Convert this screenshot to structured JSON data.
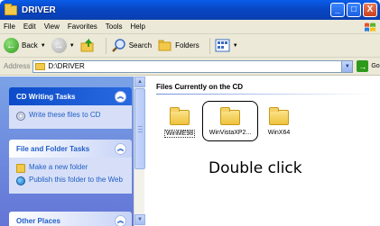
{
  "window": {
    "title": "DRIVER",
    "buttons": {
      "minimize": "_",
      "maximize": "□",
      "close": "X"
    }
  },
  "menu": [
    "File",
    "Edit",
    "View",
    "Favorites",
    "Tools",
    "Help"
  ],
  "toolbar": {
    "back_label": "Back",
    "search_label": "Search",
    "folders_label": "Folders"
  },
  "address": {
    "label": "Address",
    "value": "D:\\DRIVER",
    "go_label": "Go"
  },
  "task_pane": {
    "cd_tasks": {
      "title": "CD Writing Tasks",
      "items": [
        "Write these files to CD"
      ]
    },
    "file_folder_tasks": {
      "title": "File and Folder Tasks",
      "items": [
        "Make a new folder",
        "Publish this folder to the Web"
      ]
    },
    "other_places": {
      "title": "Other Places"
    }
  },
  "content": {
    "section_title": "Files Currently on the CD",
    "folders": [
      "WinME98",
      "WinVistaXP2...",
      "WinX64"
    ],
    "caption": "Double click"
  },
  "colors": {
    "titlebar": "#0a5ce8",
    "task_pane_bg": "#7ba2e7",
    "link": "#215dc6"
  }
}
